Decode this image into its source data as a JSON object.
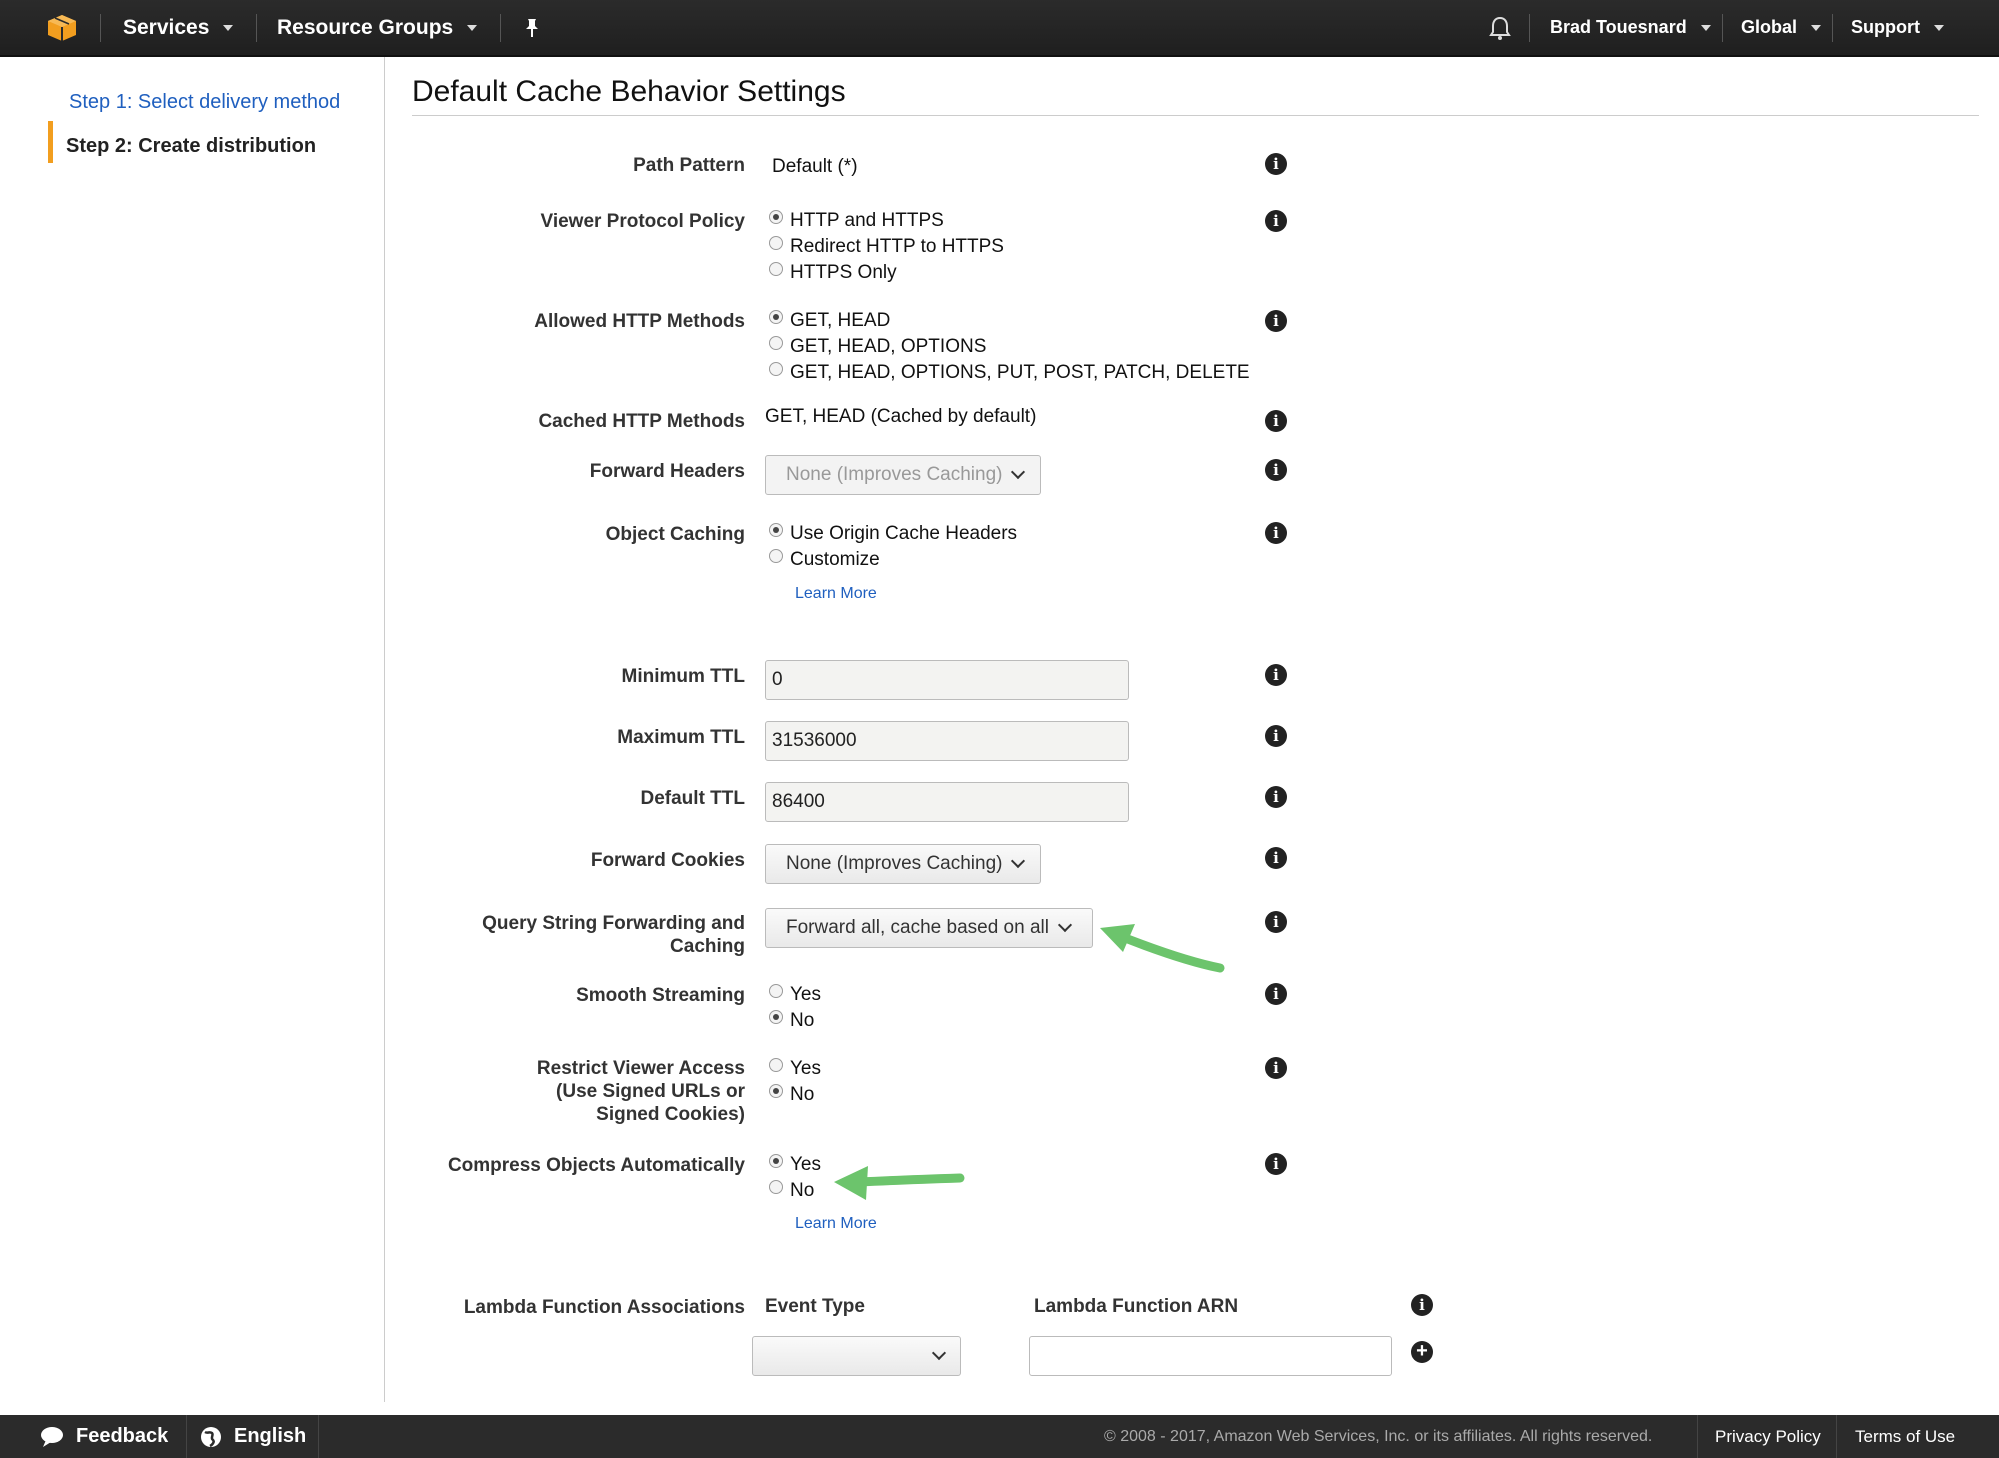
{
  "nav": {
    "services": "Services",
    "resource_groups": "Resource Groups",
    "user": "Brad Touesnard",
    "region": "Global",
    "support": "Support"
  },
  "sidebar": {
    "step1": "Step 1: Select delivery method",
    "step2": "Step 2: Create distribution"
  },
  "main": {
    "title": "Default Cache Behavior Settings",
    "path_pattern": {
      "label": "Path Pattern",
      "value": "Default (*)"
    },
    "viewer_protocol": {
      "label": "Viewer Protocol Policy",
      "options": [
        "HTTP and HTTPS",
        "Redirect HTTP to HTTPS",
        "HTTPS Only"
      ],
      "selected": 0
    },
    "allowed_methods": {
      "label": "Allowed HTTP Methods",
      "options": [
        "GET, HEAD",
        "GET, HEAD, OPTIONS",
        "GET, HEAD, OPTIONS, PUT, POST, PATCH, DELETE"
      ],
      "selected": 0
    },
    "cached_methods": {
      "label": "Cached HTTP Methods",
      "value": "GET, HEAD (Cached by default)"
    },
    "forward_headers": {
      "label": "Forward Headers",
      "value": "None (Improves Caching)"
    },
    "object_caching": {
      "label": "Object Caching",
      "options": [
        "Use Origin Cache Headers",
        "Customize"
      ],
      "selected": 0,
      "learn_more": "Learn More"
    },
    "min_ttl": {
      "label": "Minimum TTL",
      "value": "0"
    },
    "max_ttl": {
      "label": "Maximum TTL",
      "value": "31536000"
    },
    "default_ttl": {
      "label": "Default TTL",
      "value": "86400"
    },
    "forward_cookies": {
      "label": "Forward Cookies",
      "value": "None (Improves Caching)"
    },
    "query_string": {
      "label_line1": "Query String Forwarding and",
      "label_line2": "Caching",
      "value": "Forward all, cache based on all"
    },
    "smooth_streaming": {
      "label": "Smooth Streaming",
      "options": [
        "Yes",
        "No"
      ],
      "selected": 1
    },
    "restrict_viewer": {
      "label_line1": "Restrict Viewer Access",
      "label_line2": "(Use Signed URLs or",
      "label_line3": "Signed Cookies)",
      "options": [
        "Yes",
        "No"
      ],
      "selected": 1
    },
    "compress": {
      "label": "Compress Objects Automatically",
      "options": [
        "Yes",
        "No"
      ],
      "selected": 0,
      "learn_more": "Learn More"
    },
    "lambda": {
      "label": "Lambda Function Associations",
      "event_type_header": "Event Type",
      "arn_header": "Lambda Function ARN",
      "event_type_value": "",
      "arn_value": ""
    }
  },
  "footer": {
    "feedback": "Feedback",
    "language": "English",
    "copyright": "© 2008 - 2017, Amazon Web Services, Inc. or its affiliates. All rights reserved.",
    "privacy": "Privacy Policy",
    "terms": "Terms of Use"
  },
  "colors": {
    "nav_bg": "#232323",
    "accent_orange": "#f29e1f",
    "link_blue": "#1f5fbf",
    "annotation_green": "#6cc46c"
  }
}
